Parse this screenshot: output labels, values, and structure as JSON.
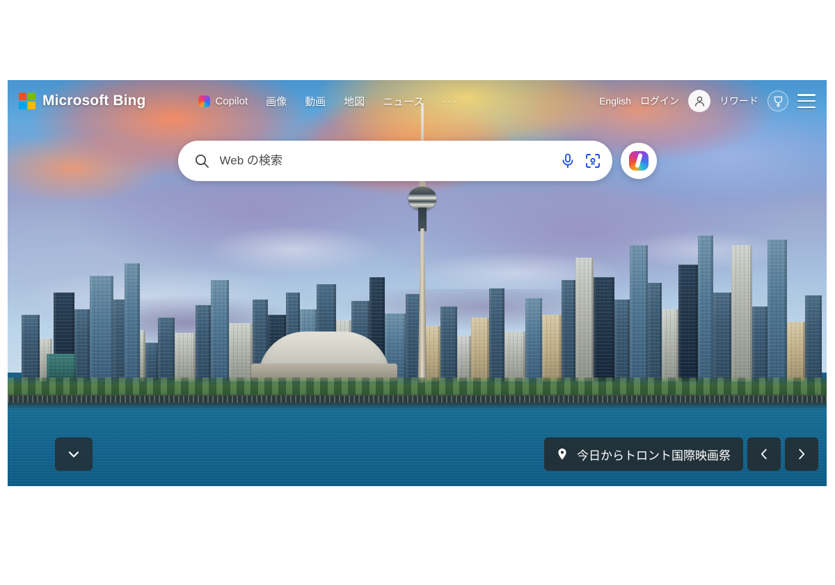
{
  "brand": {
    "name": "Microsoft Bing",
    "logo_icon": "microsoft-logo-icon",
    "logo_colors": [
      "#f25022",
      "#7fba00",
      "#00a4ef",
      "#ffb900"
    ]
  },
  "header": {
    "copilot": {
      "label": "Copilot",
      "icon": "copilot-icon"
    },
    "nav_items": [
      {
        "label": "画像",
        "name": "images"
      },
      {
        "label": "動画",
        "name": "videos"
      },
      {
        "label": "地図",
        "name": "maps"
      },
      {
        "label": "ニュース",
        "name": "news"
      }
    ],
    "more_label": "···",
    "language_label": "English",
    "signin_label": "ログイン",
    "account_icon": "person-icon",
    "rewards_label": "リワード",
    "rewards_icon": "medal-icon",
    "menu_icon": "hamburger-menu-icon"
  },
  "search": {
    "placeholder": "Web の検索",
    "value": "",
    "search_icon": "search-icon",
    "mic_icon": "microphone-icon",
    "lens_icon": "visual-search-icon",
    "copilot_button_icon": "copilot-icon",
    "accent_color": "#174ae4"
  },
  "hero": {
    "scroll_down_icon": "chevron-down-icon",
    "caption": {
      "location_icon": "location-pin-icon",
      "text": "今日からトロント国際映画祭"
    },
    "prev_icon": "chevron-left-icon",
    "next_icon": "chevron-right-icon"
  }
}
